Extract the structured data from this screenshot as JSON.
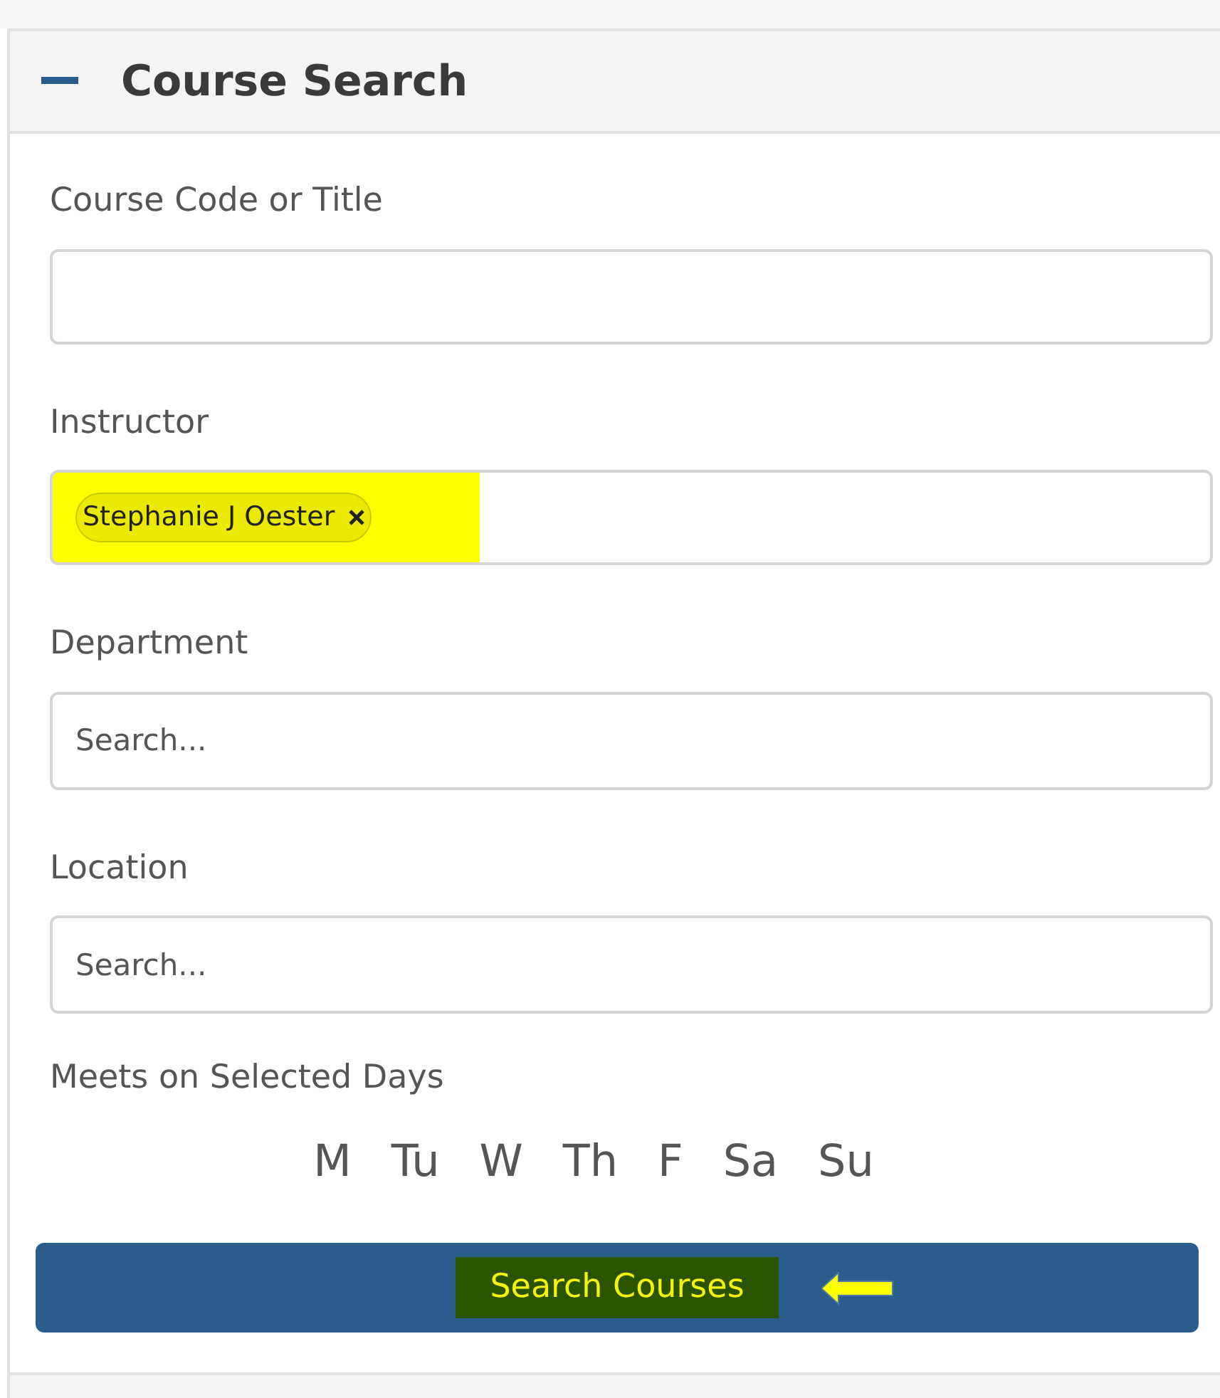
{
  "panel": {
    "title": "Course Search",
    "expanded": true
  },
  "fields": [
    {
      "label": "Course Code or Title",
      "kind": "text"
    },
    {
      "label": "Instructor",
      "kind": "tags",
      "tags": [
        "Stephanie J Oester"
      ]
    },
    {
      "label": "Department",
      "kind": "text",
      "placeholder": "Search..."
    },
    {
      "label": "Location",
      "kind": "text",
      "placeholder": "Search..."
    }
  ],
  "days": {
    "label": "Meets on Selected Days",
    "items": [
      {
        "label": "M",
        "selected": false
      },
      {
        "label": "Tu",
        "selected": false
      },
      {
        "label": "W",
        "selected": false
      },
      {
        "label": "Th",
        "selected": false
      },
      {
        "label": "F",
        "selected": false
      },
      {
        "label": "Sa",
        "selected": false
      },
      {
        "label": "Su",
        "selected": false
      }
    ]
  },
  "search_button": {
    "label": "Search Courses"
  },
  "next_panel": {
    "expanded": false
  }
}
